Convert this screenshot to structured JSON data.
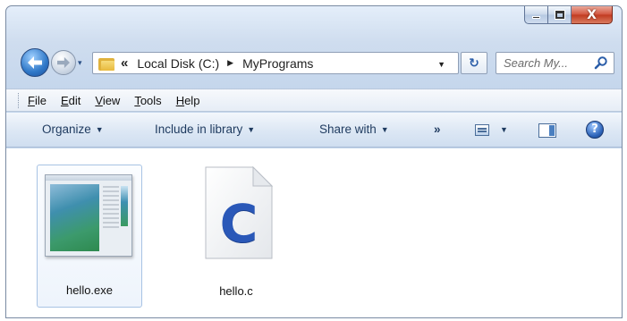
{
  "window": {
    "caption_buttons": {
      "minimize_icon": "minimize-icon",
      "maximize_icon": "maximize-icon",
      "close_glyph": "X"
    }
  },
  "navigation": {
    "back_icon": "back-arrow-icon",
    "forward_icon": "forward-arrow-icon",
    "recent_glyph": "▾"
  },
  "address_bar": {
    "overflow_glyph": "«",
    "breadcrumb": [
      "Local Disk (C:)",
      "MyPrograms"
    ],
    "separator_glyph": "▶",
    "dropdown_glyph": "▼",
    "refresh_glyph": "↻"
  },
  "search": {
    "placeholder": "Search My..."
  },
  "menu": [
    "File",
    "Edit",
    "View",
    "Tools",
    "Help"
  ],
  "commands": {
    "organize": "Organize",
    "include_in_library": "Include in library",
    "share_with": "Share with",
    "more": "»",
    "dropdown_glyph": "▼",
    "help_glyph": "?"
  },
  "files": [
    {
      "name": "hello.exe",
      "icon": "application-icon",
      "selected": true
    },
    {
      "name": "hello.c",
      "icon": "c-source-file-icon",
      "letter": "C",
      "selected": false
    }
  ],
  "colors": {
    "selection_border": "#a8c3e4",
    "close_button": "#c03b20",
    "c_icon": "#2a58b8"
  }
}
